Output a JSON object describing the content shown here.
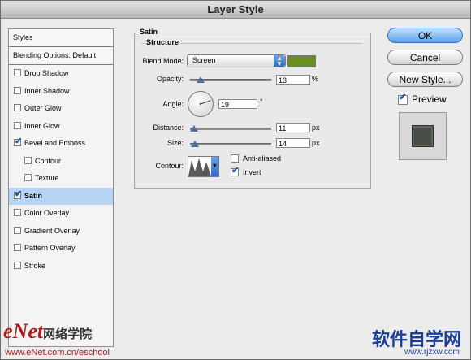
{
  "window": {
    "title": "Layer Style"
  },
  "sidebar": {
    "header": "Styles",
    "blending": "Blending Options: Default",
    "items": [
      {
        "label": "Drop Shadow",
        "checked": false,
        "indent": false,
        "selected": false
      },
      {
        "label": "Inner Shadow",
        "checked": false,
        "indent": false,
        "selected": false
      },
      {
        "label": "Outer Glow",
        "checked": false,
        "indent": false,
        "selected": false
      },
      {
        "label": "Inner Glow",
        "checked": false,
        "indent": false,
        "selected": false
      },
      {
        "label": "Bevel and Emboss",
        "checked": true,
        "indent": false,
        "selected": false
      },
      {
        "label": "Contour",
        "checked": false,
        "indent": true,
        "selected": false
      },
      {
        "label": "Texture",
        "checked": false,
        "indent": true,
        "selected": false
      },
      {
        "label": "Satin",
        "checked": true,
        "indent": false,
        "selected": true
      },
      {
        "label": "Color Overlay",
        "checked": false,
        "indent": false,
        "selected": false
      },
      {
        "label": "Gradient Overlay",
        "checked": false,
        "indent": false,
        "selected": false
      },
      {
        "label": "Pattern Overlay",
        "checked": false,
        "indent": false,
        "selected": false
      },
      {
        "label": "Stroke",
        "checked": false,
        "indent": false,
        "selected": false
      }
    ]
  },
  "panel": {
    "section": "Satin",
    "group": "Structure",
    "blend_mode_label": "Blend Mode:",
    "blend_mode": "Screen",
    "blend_color": "#6b8f1f",
    "opacity_label": "Opacity:",
    "opacity": "13",
    "opacity_unit": "%",
    "opacity_level": 0.13,
    "angle_label": "Angle:",
    "angle": "19",
    "angle_unit": "°",
    "distance_label": "Distance:",
    "distance": "11",
    "distance_unit": "px",
    "distance_level": 0.05,
    "size_label": "Size:",
    "size": "14",
    "size_unit": "px",
    "size_level": 0.06,
    "contour_label": "Contour:",
    "anti_aliased": "Anti-aliased",
    "anti_aliased_checked": false,
    "invert": "Invert",
    "invert_checked": true
  },
  "buttons": {
    "ok": "OK",
    "cancel": "Cancel",
    "new_style": "New Style...",
    "preview": "Preview",
    "preview_checked": true
  },
  "watermarks": {
    "enet_logo": "eNet",
    "enet_cn": "网络学院",
    "enet_url": "www.eNet.com.cn/eschool",
    "rj_logo": "软件自学网",
    "rj_url": "www.rjzxw.com"
  }
}
